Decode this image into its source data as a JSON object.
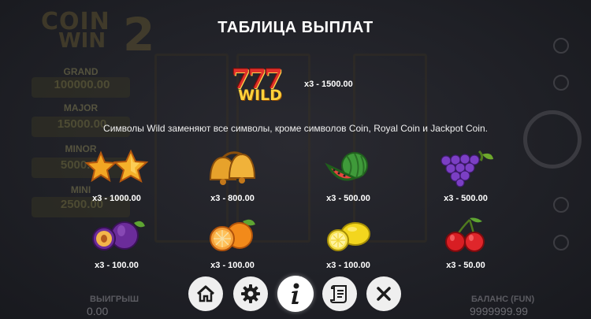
{
  "title": "ТАБЛИЦА ВЫПЛАТ",
  "wild": {
    "sevens": "777",
    "label": "WILD",
    "payout": "x3 - 1500.00",
    "description": "Символы Wild заменяют все символы, кроме символов Coin, Royal Coin и Jackpot Coin."
  },
  "symbols": [
    {
      "name": "stars",
      "payout": "x3 - 1000.00"
    },
    {
      "name": "bells",
      "payout": "x3 - 800.00"
    },
    {
      "name": "watermelon",
      "payout": "x3 - 500.00"
    },
    {
      "name": "grapes",
      "payout": "x3 - 500.00"
    },
    {
      "name": "plum",
      "payout": "x3 - 100.00"
    },
    {
      "name": "orange",
      "payout": "x3 - 100.00"
    },
    {
      "name": "lemon",
      "payout": "x3 - 100.00"
    },
    {
      "name": "cherries",
      "payout": "x3 - 50.00"
    }
  ],
  "buttons": [
    {
      "icon": "home-icon"
    },
    {
      "icon": "gear-icon"
    },
    {
      "icon": "info-icon",
      "active": true
    },
    {
      "icon": "scroll-icon"
    },
    {
      "icon": "close-icon"
    }
  ],
  "background": {
    "logo_line1": "COIN",
    "logo_line2": "WIN",
    "logo_digit": "2",
    "jackpot_grand_label": "GRAND",
    "jackpot_grand_value": "100000.00",
    "jackpot_major_label": "MAJOR",
    "jackpot_major_value": "15000.00",
    "jackpot_minor_label": "MINOR",
    "jackpot_minor_value": "5000.00",
    "jackpot_mini_label": "MINI",
    "jackpot_mini_value": "2500.00",
    "win_label": "ВЫИГРЫШ",
    "win_value": "0.00",
    "balance_label": "БАЛАНС (FUN)",
    "balance_value": "9999999.99"
  },
  "colors": {
    "overlay_bg": "#1b1c22",
    "button_bg": "#efefef",
    "icon_dark": "#1c1c1c",
    "gold": "#ffd23c",
    "red": "#e0312a"
  }
}
